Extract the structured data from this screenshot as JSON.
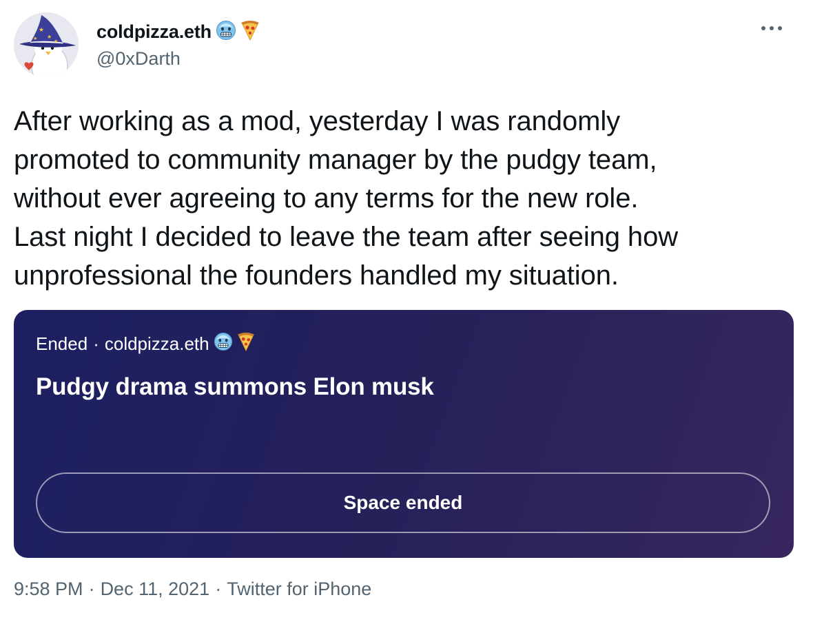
{
  "author": {
    "display_name": "coldpizza.eth",
    "handle": "@0xDarth",
    "name_emojis": [
      "cold-face-emoji",
      "pizza-emoji"
    ]
  },
  "tweet": {
    "text": "After working as a mod, yesterday I was randomly\npromoted to community manager by the pudgy team,\nwithout ever agreeing to any terms for the new role.\nLast night I decided to leave the team after seeing how\nunprofessional the founders handled my situation.",
    "time": "9:58 PM",
    "date": "Dec 11, 2021",
    "source": "Twitter for iPhone",
    "separator": "·"
  },
  "space": {
    "status": "Ended",
    "separator": "·",
    "host": "coldpizza.eth",
    "title": "Pudgy drama summons Elon musk",
    "button_label": "Space ended",
    "gradient_start": "#1d1f62",
    "gradient_end": "#38265f"
  },
  "colors": {
    "text_primary": "#0f1419",
    "text_secondary": "#536471"
  },
  "icons": {
    "more": "more-horizontal-icon"
  }
}
